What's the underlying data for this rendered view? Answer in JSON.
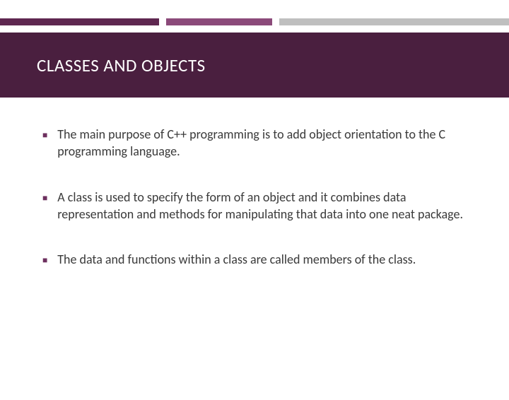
{
  "slide": {
    "title": "CLASSES AND OBJECTS",
    "bullets": [
      "The main purpose of C++ programming is to add object orientation to the C programming language.",
      "A class is used to specify the form of an object and it combines data representation and methods for manipulating that data into one neat package.",
      "The data and functions within a class are called members of the class."
    ]
  },
  "colors": {
    "title_band": "#4a1f3f",
    "stripe_dark": "#5e2750",
    "stripe_mid": "#8b4a7a",
    "stripe_light": "#bfbfbf",
    "bullet_marker": "#6d2f5e"
  }
}
